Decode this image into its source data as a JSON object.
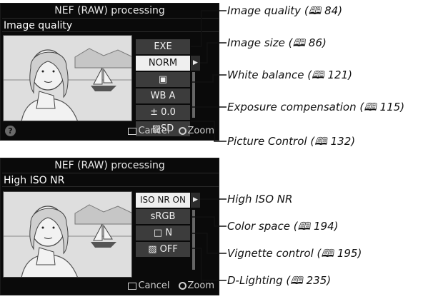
{
  "screen1": {
    "title": "NEF (RAW) processing",
    "subtitle": "Image quality",
    "options": [
      "EXE",
      "NORM",
      "▣",
      "WB A",
      "± 0.0",
      "▨SD"
    ],
    "help": "?",
    "cancel": "Cancel",
    "zoom": "Zoom"
  },
  "screen2": {
    "title": "NEF (RAW) processing",
    "subtitle": "High ISO NR",
    "options": [
      "ISO NR ON",
      "sRGB",
      "□ N",
      "▨ OFF"
    ],
    "cancel": "Cancel",
    "zoom": "Zoom"
  },
  "callouts_top": [
    "Image quality (🕮 84)",
    "Image size (🕮 86)",
    "White balance (🕮 121)",
    "Exposure compensation (🕮 115)",
    "Picture Control (🕮 132)"
  ],
  "callouts_bottom": [
    "High ISO NR",
    "Color space (🕮 194)",
    "Vignette control (🕮 195)",
    "D-Lighting (🕮 235)"
  ]
}
